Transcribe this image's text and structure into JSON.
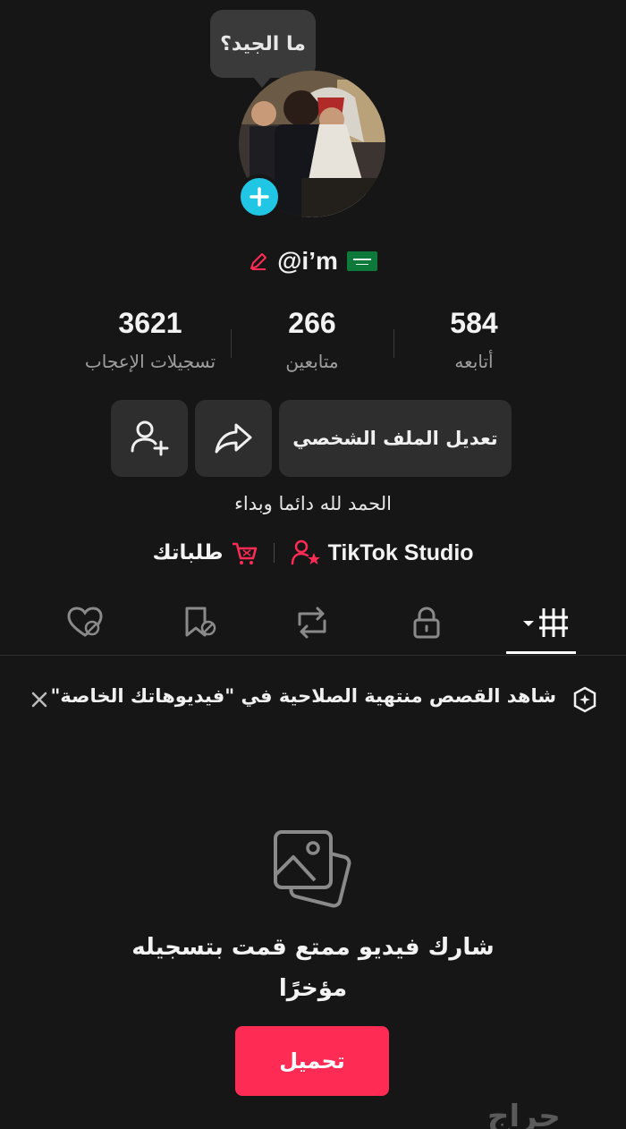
{
  "profile": {
    "note": "ما الجيد؟",
    "username": "@i’m",
    "stats": [
      {
        "value": "3621",
        "label": "تسجيلات الإعجاب"
      },
      {
        "value": "266",
        "label": "متابعين"
      },
      {
        "value": "584",
        "label": "أتابعه"
      }
    ],
    "edit_profile_label": "تعديل الملف الشخصي",
    "bio": "الحمد لله دائما وبداء",
    "links": {
      "studio": "TikTok Studio",
      "orders": "طلباتك"
    }
  },
  "banner": {
    "text": "شاهد القصص منتهية الصلاحية في \"فيديوهاتك الخاصة\""
  },
  "empty_state": {
    "line1": "شارك فيديو ممتع قمت بتسجيله",
    "line2": "مؤخرًا",
    "upload_label": "تحميل"
  },
  "watermark": "حراج",
  "colors": {
    "accent": "#fe2c55",
    "add_badge": "#20c6e3",
    "background": "#161616"
  },
  "icons": [
    "plus-icon",
    "pencil-icon",
    "flag-icon",
    "add-friend-icon",
    "share-icon",
    "studio-icon",
    "cart-icon",
    "videos-grid-icon",
    "lock-icon",
    "repost-icon",
    "favorites-icon",
    "liked-icon",
    "sparkle-icon",
    "close-icon",
    "photo-icon"
  ]
}
